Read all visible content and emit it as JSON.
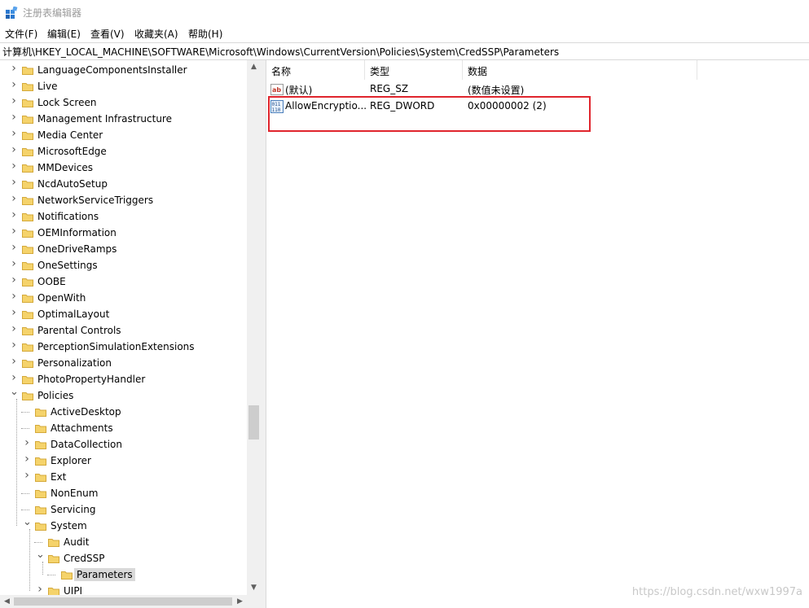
{
  "window": {
    "title": "注册表编辑器"
  },
  "menu": [
    "文件(F)",
    "编辑(E)",
    "查看(V)",
    "收藏夹(A)",
    "帮助(H)"
  ],
  "address": "计算机\\HKEY_LOCAL_MACHINE\\SOFTWARE\\Microsoft\\Windows\\CurrentVersion\\Policies\\System\\CredSSP\\Parameters",
  "tree": [
    {
      "label": "LanguageComponentsInstaller",
      "level": 0,
      "expander": "collapsed"
    },
    {
      "label": "Live",
      "level": 0,
      "expander": "collapsed"
    },
    {
      "label": "Lock Screen",
      "level": 0,
      "expander": "collapsed"
    },
    {
      "label": "Management Infrastructure",
      "level": 0,
      "expander": "collapsed"
    },
    {
      "label": "Media Center",
      "level": 0,
      "expander": "collapsed"
    },
    {
      "label": "MicrosoftEdge",
      "level": 0,
      "expander": "collapsed"
    },
    {
      "label": "MMDevices",
      "level": 0,
      "expander": "collapsed"
    },
    {
      "label": "NcdAutoSetup",
      "level": 0,
      "expander": "collapsed"
    },
    {
      "label": "NetworkServiceTriggers",
      "level": 0,
      "expander": "collapsed"
    },
    {
      "label": "Notifications",
      "level": 0,
      "expander": "collapsed"
    },
    {
      "label": "OEMInformation",
      "level": 0,
      "expander": "collapsed"
    },
    {
      "label": "OneDriveRamps",
      "level": 0,
      "expander": "collapsed"
    },
    {
      "label": "OneSettings",
      "level": 0,
      "expander": "collapsed"
    },
    {
      "label": "OOBE",
      "level": 0,
      "expander": "collapsed"
    },
    {
      "label": "OpenWith",
      "level": 0,
      "expander": "collapsed"
    },
    {
      "label": "OptimalLayout",
      "level": 0,
      "expander": "collapsed"
    },
    {
      "label": "Parental Controls",
      "level": 0,
      "expander": "collapsed"
    },
    {
      "label": "PerceptionSimulationExtensions",
      "level": 0,
      "expander": "collapsed"
    },
    {
      "label": "Personalization",
      "level": 0,
      "expander": "collapsed"
    },
    {
      "label": "PhotoPropertyHandler",
      "level": 0,
      "expander": "collapsed"
    },
    {
      "label": "Policies",
      "level": 0,
      "expander": "expanded"
    },
    {
      "label": "ActiveDesktop",
      "level": 1,
      "expander": "none"
    },
    {
      "label": "Attachments",
      "level": 1,
      "expander": "none"
    },
    {
      "label": "DataCollection",
      "level": 1,
      "expander": "collapsed"
    },
    {
      "label": "Explorer",
      "level": 1,
      "expander": "collapsed"
    },
    {
      "label": "Ext",
      "level": 1,
      "expander": "collapsed"
    },
    {
      "label": "NonEnum",
      "level": 1,
      "expander": "none"
    },
    {
      "label": "Servicing",
      "level": 1,
      "expander": "none"
    },
    {
      "label": "System",
      "level": 1,
      "expander": "expanded"
    },
    {
      "label": "Audit",
      "level": 2,
      "expander": "none"
    },
    {
      "label": "CredSSP",
      "level": 2,
      "expander": "expanded"
    },
    {
      "label": "Parameters",
      "level": 3,
      "expander": "none",
      "selected": true
    },
    {
      "label": "UIPI",
      "level": 2,
      "expander": "collapsed"
    }
  ],
  "values_pane": {
    "columns": [
      "名称",
      "类型",
      "数据"
    ],
    "rows": [
      {
        "icon": "string-value-icon",
        "name": "(默认)",
        "type": "REG_SZ",
        "data": "(数值未设置)"
      },
      {
        "icon": "dword-value-icon",
        "name": "AllowEncryptio...",
        "type": "REG_DWORD",
        "data": "0x00000002 (2)"
      }
    ],
    "highlight_color": "#e0252d"
  },
  "colors": {
    "folder": "#f5d36b",
    "selected_bg": "#d9d9d9"
  },
  "watermark": "https://blog.csdn.net/wxw1997a"
}
